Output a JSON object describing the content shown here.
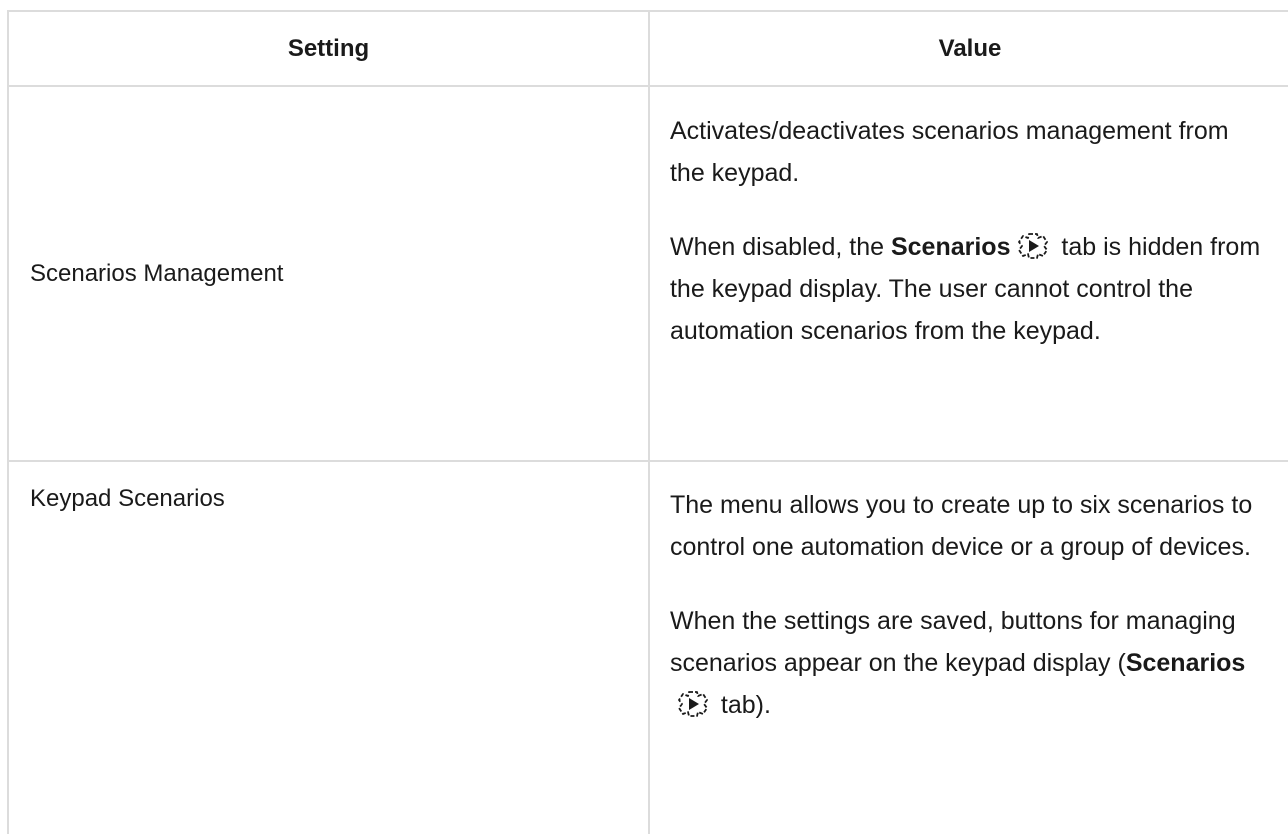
{
  "table": {
    "header": {
      "setting": "Setting",
      "value": "Value"
    },
    "rows": [
      {
        "setting": "Scenarios Management",
        "value_p1": "Activates/deactivates scenarios management from the keypad.",
        "value_p2_before": "When disabled, the ",
        "value_p2_bold": "Scenarios",
        "value_p2_icon": "scenarios-icon",
        "value_p2_after": " tab is hidden from the keypad display. The user cannot control the automation scenarios from the keypad."
      },
      {
        "setting": "Keypad Scenarios",
        "value_p1": "The menu allows you to create up to six scenarios to control one automation device or a group of devices.",
        "value_p2_before": "When the settings are saved, buttons for managing scenarios appear on the keypad display (",
        "value_p2_bold": "Scenarios",
        "value_p2_icon": "scenarios-icon",
        "value_p2_after": " tab)."
      }
    ]
  }
}
